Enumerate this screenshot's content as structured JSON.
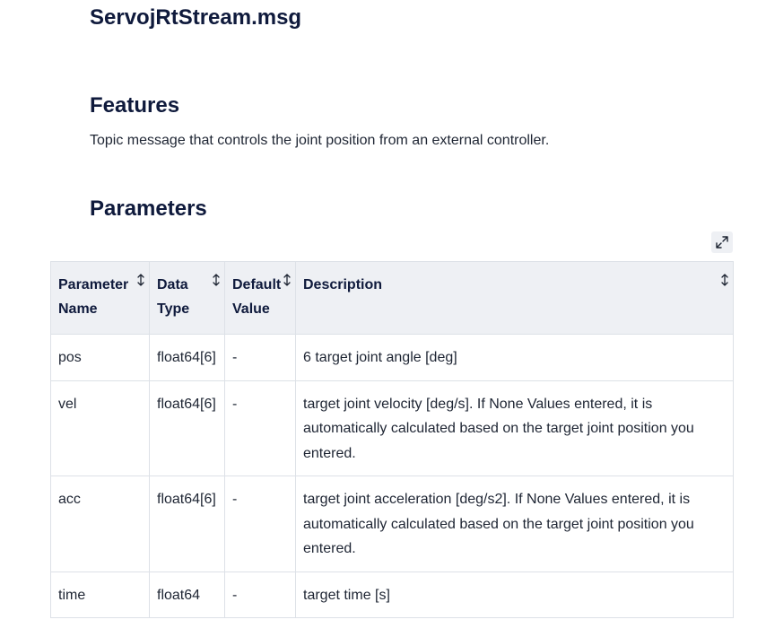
{
  "doc": {
    "title": "ServojRtStream.msg"
  },
  "features": {
    "heading": "Features",
    "description": "Topic message that controls the joint position from an external controller."
  },
  "parameters": {
    "heading": "Parameters",
    "expand_icon": "expand-icon",
    "sort_icon": "sort-arrows-icon",
    "columns": [
      {
        "label": "Parameter Name"
      },
      {
        "label": "Data Type"
      },
      {
        "label": "Default Value"
      },
      {
        "label": "Description"
      }
    ],
    "rows": [
      {
        "name": "pos",
        "type": "float64[6]",
        "default": "-",
        "description": "6 target joint angle [deg]"
      },
      {
        "name": "vel",
        "type": "float64[6]",
        "default": "-",
        "description": "target joint velocity [deg/s]. If None Values entered, it is automatically calculated based on the target joint position you entered."
      },
      {
        "name": "acc",
        "type": "float64[6]",
        "default": "-",
        "description": "target joint acceleration [deg/s2]. If None Values entered, it is automatically calculated based on the target joint position you entered."
      },
      {
        "name": "time",
        "type": "float64",
        "default": "-",
        "description": "target time [s]"
      }
    ]
  },
  "colors": {
    "heading": "#0f1a3c",
    "text": "#1e2533",
    "header_bg": "#eef0f4",
    "border": "#dde1e7"
  }
}
